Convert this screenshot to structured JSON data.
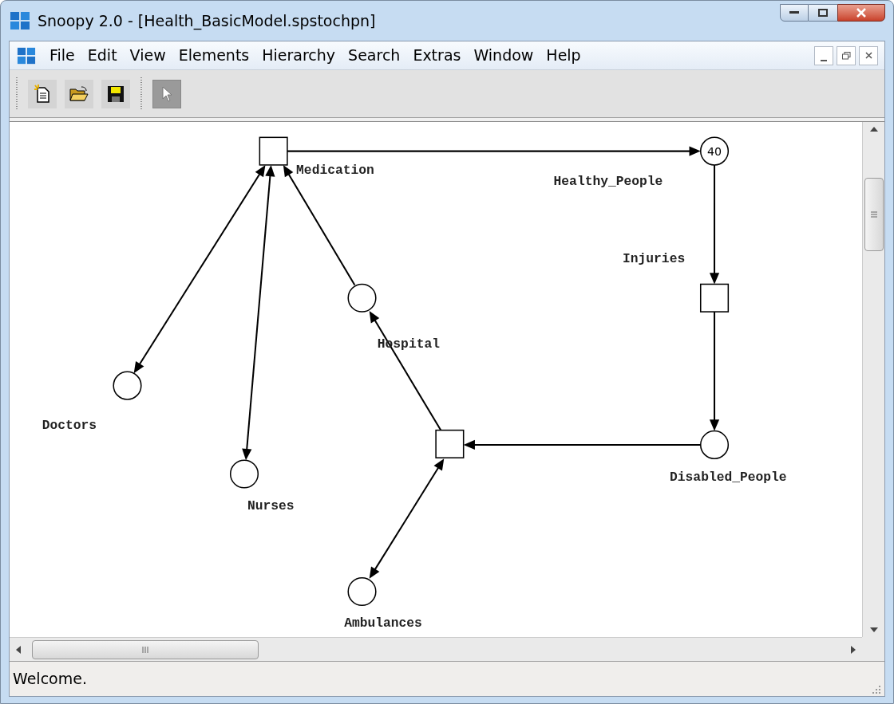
{
  "window": {
    "title": "Snoopy 2.0 - [Health_BasicModel.spstochpn]"
  },
  "menu": [
    "File",
    "Edit",
    "View",
    "Elements",
    "Hierarchy",
    "Search",
    "Extras",
    "Window",
    "Help"
  ],
  "toolbar": [
    {
      "kind": "new",
      "selected": false
    },
    {
      "kind": "open",
      "selected": false
    },
    {
      "kind": "save",
      "selected": false
    },
    {
      "kind": "pointer",
      "selected": true
    }
  ],
  "nodes": [
    {
      "kind": "transition",
      "label": "Medication"
    },
    {
      "kind": "place",
      "label": "Healthy_People",
      "tokens": "40"
    },
    {
      "kind": "transition",
      "label": "Injuries"
    },
    {
      "kind": "place",
      "label": "Disabled_People"
    },
    {
      "kind": "place",
      "label": "Hospital"
    },
    {
      "kind": "place",
      "label": "Doctors"
    },
    {
      "kind": "place",
      "label": "Nurses"
    },
    {
      "kind": "transition"
    },
    {
      "kind": "place",
      "label": "Ambulances"
    }
  ],
  "arcs": [
    {
      "bidirectional": false
    },
    {
      "bidirectional": false
    },
    {
      "bidirectional": false
    },
    {
      "bidirectional": false
    },
    {
      "bidirectional": false
    },
    {
      "bidirectional": false
    },
    {
      "bidirectional": true
    },
    {
      "bidirectional": true
    },
    {
      "bidirectional": true
    }
  ],
  "status_bar": "Welcome."
}
